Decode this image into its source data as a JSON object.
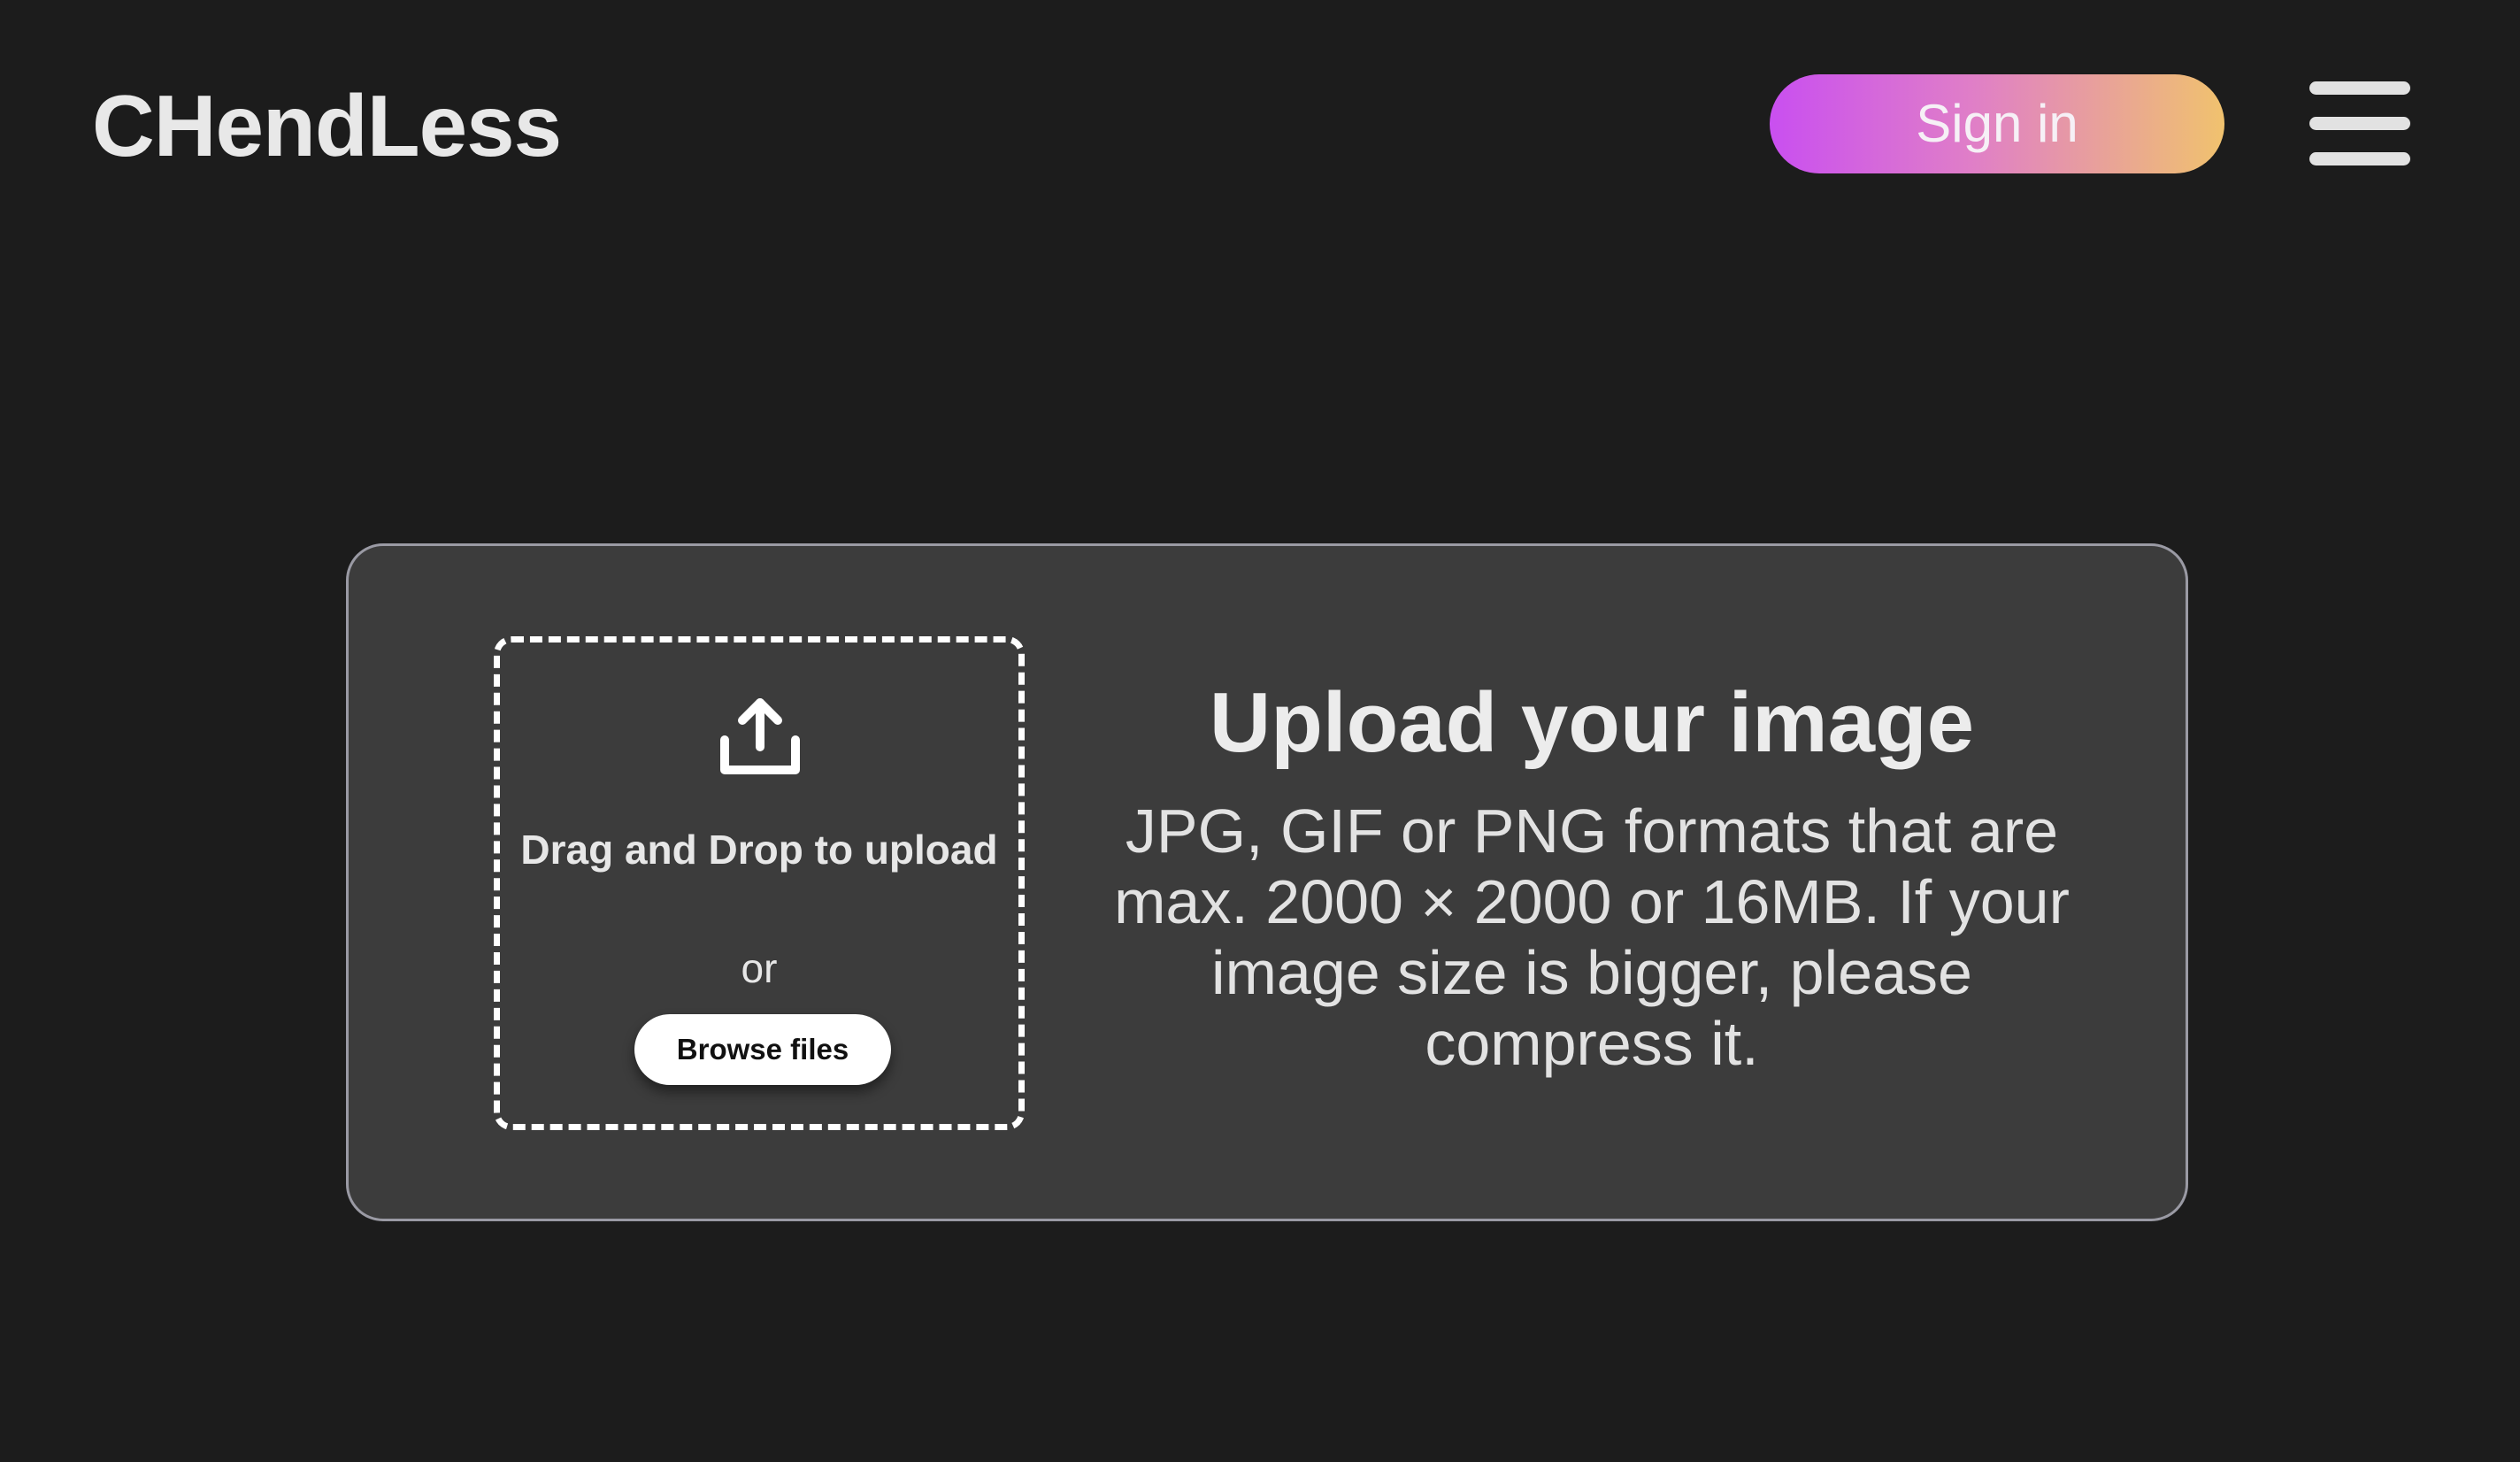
{
  "header": {
    "logo": "CHendLess",
    "signin_label": "Sign in",
    "menu_icon": "hamburger-menu-icon"
  },
  "upload": {
    "icon": "upload-icon",
    "drag_text": "Drag and Drop to upload",
    "or_text": "or",
    "browse_label": "Browse files",
    "title": "Upload your image",
    "description": "JPG, GIF or PNG formats that are max. 2000 × 2000 or 16MB. If your image size is bigger, please compress it."
  },
  "colors": {
    "background": "#1c1c1c",
    "card": "#3c3c3c",
    "signin_gradient_start": "#c94ff0",
    "signin_gradient_end": "#f0c26e"
  }
}
